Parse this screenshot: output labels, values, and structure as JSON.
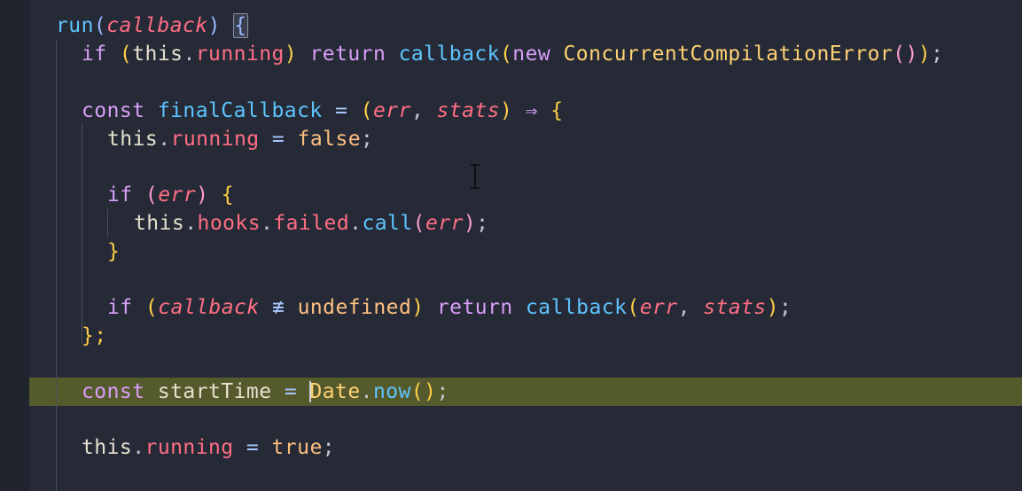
{
  "editor": {
    "language": "javascript",
    "highlighted_line": 14,
    "colors": {
      "background": "#252a36",
      "line_highlight": "#555a2c",
      "function": "#5ec4ff",
      "keyword": "#d99ef8",
      "property": "#ff6e84",
      "class": "#ffd173"
    }
  },
  "code": {
    "l1": {
      "name": "run",
      "open": "(",
      "param": "callback",
      "close": ")",
      "brace": "{"
    },
    "l2": {
      "kw_if": "if",
      "open": "(",
      "this": "this",
      "dot": ".",
      "prop": "running",
      "close": ")",
      "kw_return": "return",
      "fn": "callback",
      "open2": "(",
      "kw_new": "new",
      "cls": "ConcurrentCompilationError",
      "call": "()",
      "close2": ")",
      "semi": ";"
    },
    "l4": {
      "kw_const": "const",
      "name": "finalCallback",
      "eq": "=",
      "open": "(",
      "p1": "err",
      "comma": ",",
      "p2": "stats",
      "close": ")",
      "arrow": "⇒",
      "brace": "{"
    },
    "l5": {
      "this": "this",
      "dot": ".",
      "prop": "running",
      "eq": "=",
      "val": "false",
      "semi": ";"
    },
    "l7": {
      "kw_if": "if",
      "open": "(",
      "param": "err",
      "close": ")",
      "brace": "{"
    },
    "l8": {
      "this": "this",
      "dot1": ".",
      "p1": "hooks",
      "dot2": ".",
      "p2": "failed",
      "dot3": ".",
      "fn": "call",
      "open": "(",
      "param": "err",
      "close": ")",
      "semi": ";"
    },
    "l9": {
      "brace": "}"
    },
    "l11": {
      "kw_if": "if",
      "open": "(",
      "param": "callback",
      "op": "≢",
      "val": "undefined",
      "close": ")",
      "kw_return": "return",
      "fn": "callback",
      "open2": "(",
      "p1": "err",
      "comma": ",",
      "p2": "stats",
      "close2": ")",
      "semi": ";"
    },
    "l12": {
      "close": "};"
    },
    "l14": {
      "kw_const": "const",
      "name": "startTime",
      "eq": "=",
      "cls": "Date",
      "dot": ".",
      "fn": "now",
      "call": "()",
      "semi": ";"
    },
    "l16": {
      "this": "this",
      "dot": ".",
      "prop": "running",
      "eq": "=",
      "val": "true",
      "semi": ";"
    }
  }
}
